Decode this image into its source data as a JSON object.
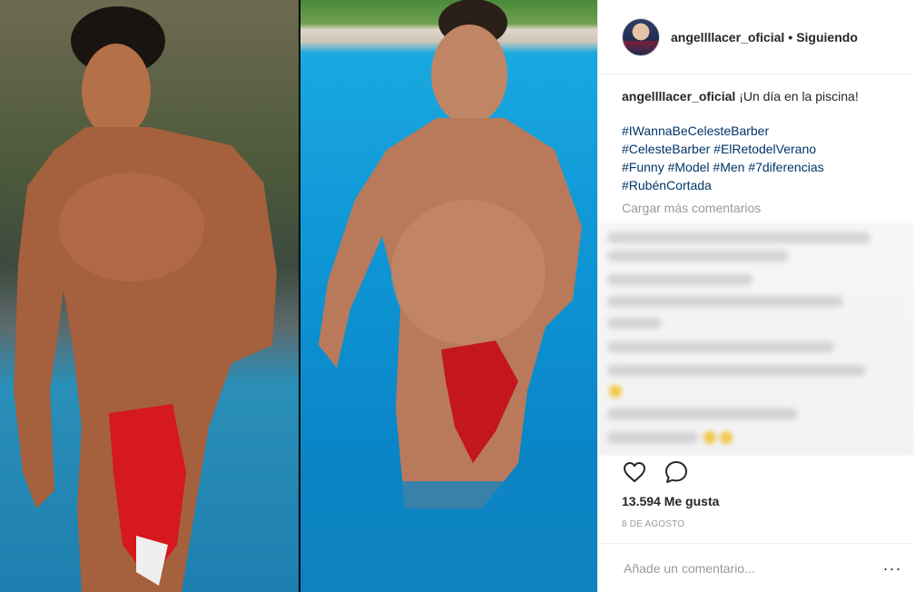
{
  "post": {
    "username": "angellllacer_oficial",
    "separator": "•",
    "follow_status": "Siguiendo",
    "caption_text": "¡Un día en la piscina!",
    "hashtags": [
      "#IWannaBeCelesteBarber",
      "#CelesteBarber",
      "#ElRetodelVerano",
      "#Funny",
      "#Model",
      "#Men",
      "#7diferencias",
      "#RubénCortada"
    ],
    "load_more_label": "Cargar más comentarios",
    "likes_label": "13.594 Me gusta",
    "date_label": "8 DE AGOSTO",
    "comment_placeholder": "Añade un comentario...",
    "more_icon": "···"
  },
  "icons": {
    "like": "heart-icon",
    "comment": "speech-bubble-icon",
    "more": "more-options-icon"
  },
  "colors": {
    "hashtag": "#003569",
    "muted": "#999999",
    "text": "#262626"
  }
}
